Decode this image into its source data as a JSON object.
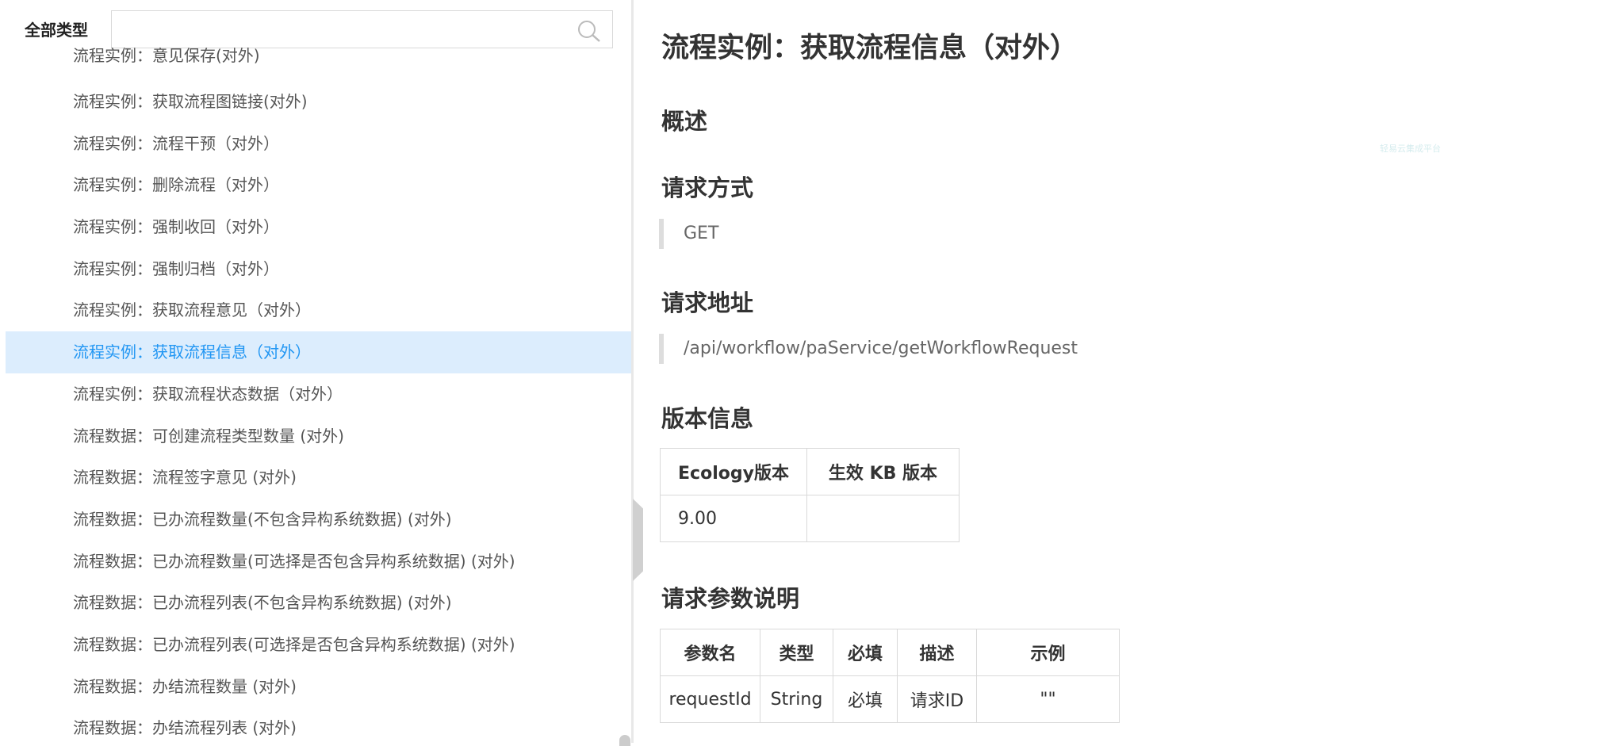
{
  "sidebar": {
    "type_label": "全部类型",
    "search_placeholder": "",
    "items": [
      {
        "label": "流程实例：意见保存(对外)"
      },
      {
        "label": "流程实例：获取流程图链接(对外)"
      },
      {
        "label": "流程实例：流程干预（对外）"
      },
      {
        "label": "流程实例：删除流程（对外）"
      },
      {
        "label": "流程实例：强制收回（对外）"
      },
      {
        "label": "流程实例：强制归档（对外）"
      },
      {
        "label": "流程实例：获取流程意见（对外）"
      },
      {
        "label": "流程实例：获取流程信息（对外）",
        "active": true
      },
      {
        "label": "流程实例：获取流程状态数据（对外）"
      },
      {
        "label": "流程数据：可创建流程类型数量 (对外)"
      },
      {
        "label": "流程数据：流程签字意见 (对外)"
      },
      {
        "label": "流程数据：已办流程数量(不包含异构系统数据) (对外)"
      },
      {
        "label": "流程数据：已办流程数量(可选择是否包含异构系统数据) (对外)"
      },
      {
        "label": "流程数据：已办流程列表(不包含异构系统数据) (对外)"
      },
      {
        "label": "流程数据：已办流程列表(可选择是否包含异构系统数据) (对外)"
      },
      {
        "label": "流程数据：办结流程数量 (对外)"
      },
      {
        "label": "流程数据：办结流程列表 (对外)"
      }
    ],
    "active_color": "#2196f3",
    "active_bg": "#dcedfd"
  },
  "content": {
    "title": "流程实例：获取流程信息（对外）",
    "overview_heading": "概述",
    "method_heading": "请求方式",
    "method": "GET",
    "url_heading": "请求地址",
    "url": "/api/workflow/paService/getWorkflowRequest",
    "version_heading": "版本信息",
    "version_table": {
      "headers": [
        "Ecology版本",
        "生效 KB 版本"
      ],
      "rows": [
        [
          "9.00",
          ""
        ]
      ]
    },
    "params_heading": "请求参数说明",
    "params_table": {
      "headers": [
        "参数名",
        "类型",
        "必填",
        "描述",
        "示例"
      ],
      "rows": [
        [
          "requestId",
          "String",
          "必填",
          "请求ID",
          "\"\""
        ]
      ]
    },
    "watermark": "轻易云集成平台"
  }
}
